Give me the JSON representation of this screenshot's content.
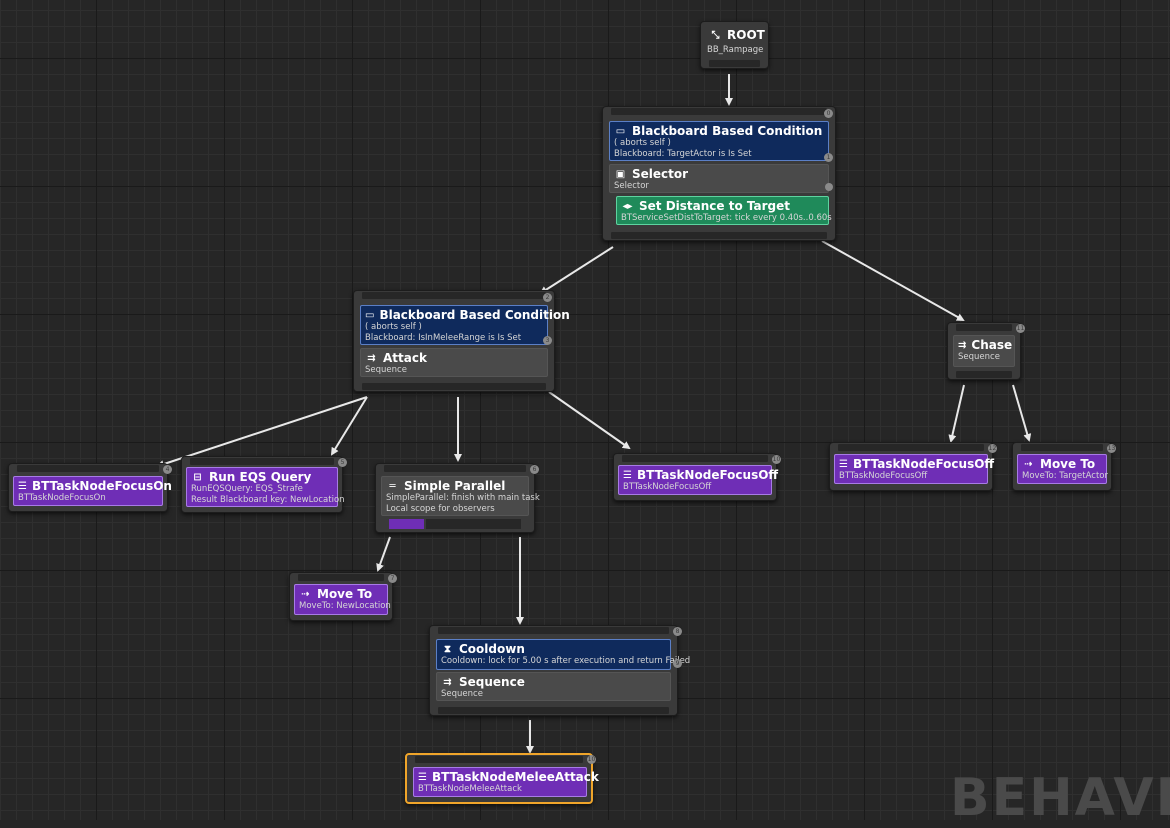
{
  "root": {
    "title": "ROOT",
    "subtitle": "BB_Rampage"
  },
  "selector_node": {
    "index": "0",
    "decorator": {
      "title": "Blackboard Based Condition",
      "line1": "( aborts self )",
      "line2": "Blackboard: TargetActor is Is Set",
      "index": "1"
    },
    "composite": {
      "title": "Selector",
      "subtitle": "Selector"
    },
    "service": {
      "title": "Set Distance to Target",
      "subtitle": "BTServiceSetDistToTarget: tick every 0.40s..0.60s"
    }
  },
  "attack_node": {
    "index": "2",
    "decorator": {
      "title": "Blackboard Based Condition",
      "line1": "( aborts self )",
      "line2": "Blackboard: IsInMeleeRange is Is Set",
      "index": "3"
    },
    "composite": {
      "title": "Attack",
      "subtitle": "Sequence"
    }
  },
  "chase_node": {
    "title": "Chase",
    "subtitle": "Sequence",
    "index": "11"
  },
  "focus_on": {
    "title": "BTTaskNodeFocusOn",
    "subtitle": "BTTaskNodeFocusOn",
    "index": "4"
  },
  "run_eqs": {
    "title": "Run EQS Query",
    "line1": "RunEQSQuery: EQS_Strafe",
    "line2": "Result Blackboard key: NewLocation",
    "index": "5"
  },
  "simple_parallel": {
    "title": "Simple Parallel",
    "line1": "SimpleParallel: finish with main task",
    "line2": "Local scope for observers",
    "index": "6"
  },
  "focus_off_1": {
    "title": "BTTaskNodeFocusOff",
    "subtitle": "BTTaskNodeFocusOff",
    "index": "10"
  },
  "focus_off_2": {
    "title": "BTTaskNodeFocusOff",
    "subtitle": "BTTaskNodeFocusOff",
    "index": "12"
  },
  "move_to_target": {
    "title": "Move To",
    "subtitle": "MoveTo: TargetActor",
    "index": "13"
  },
  "move_to_new": {
    "title": "Move To",
    "subtitle": "MoveTo: NewLocation",
    "index": "7"
  },
  "cooldown_node": {
    "index": "8",
    "decorator": {
      "title": "Cooldown",
      "line1": "Cooldown: lock for 5.00 s after execution and return Failed",
      "index": "9"
    },
    "composite": {
      "title": "Sequence",
      "subtitle": "Sequence"
    }
  },
  "melee_attack": {
    "title": "BTTaskNodeMeleeAttack",
    "subtitle": "BTTaskNodeMeleeAttack",
    "index": "10"
  },
  "watermark": "BEHAVIO",
  "colors": {
    "decorator": "#0f2a5c",
    "service": "#1f8a5a",
    "task": "#6f2eb6",
    "selected": "#f0a52a"
  }
}
